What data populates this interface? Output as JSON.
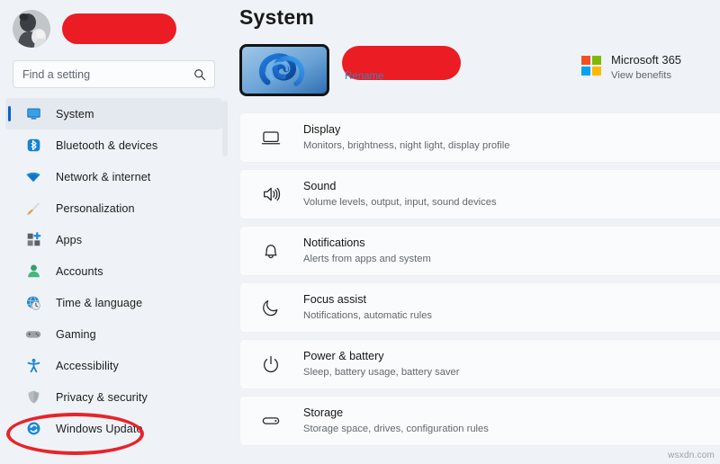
{
  "sidebar": {
    "account": {
      "avatar_name": "user-avatar",
      "name_redacted": true
    },
    "search": {
      "placeholder": "Find a setting",
      "value": "",
      "icon": "search-icon"
    },
    "items": [
      {
        "label": "System",
        "icon": "monitor-icon",
        "selected": true
      },
      {
        "label": "Bluetooth & devices",
        "icon": "bluetooth-icon",
        "selected": false
      },
      {
        "label": "Network & internet",
        "icon": "wifi-icon",
        "selected": false
      },
      {
        "label": "Personalization",
        "icon": "paintbrush-icon",
        "selected": false
      },
      {
        "label": "Apps",
        "icon": "apps-grid-icon",
        "selected": false
      },
      {
        "label": "Accounts",
        "icon": "person-icon",
        "selected": false
      },
      {
        "label": "Time & language",
        "icon": "globe-clock-icon",
        "selected": false
      },
      {
        "label": "Gaming",
        "icon": "gamepad-icon",
        "selected": false
      },
      {
        "label": "Accessibility",
        "icon": "accessibility-icon",
        "selected": false
      },
      {
        "label": "Privacy & security",
        "icon": "shield-icon",
        "selected": false
      },
      {
        "label": "Windows Update",
        "icon": "update-refresh-icon",
        "selected": false
      }
    ],
    "annotation": {
      "target_label": "Windows Update",
      "shape": "ellipse",
      "color": "#e8232a"
    }
  },
  "main": {
    "title": "System",
    "device": {
      "thumbnail": "windows11-bloom-wallpaper",
      "name_redacted": true,
      "rename_label": "Rename"
    },
    "microsoft365": {
      "title": "Microsoft 365",
      "subtitle": "View benefits",
      "logo_colors": [
        "#f25022",
        "#7fba00",
        "#00a4ef",
        "#ffb900"
      ]
    },
    "settings": [
      {
        "title": "Display",
        "subtitle": "Monitors, brightness, night light, display profile",
        "icon": "display-monitor-icon"
      },
      {
        "title": "Sound",
        "subtitle": "Volume levels, output, input, sound devices",
        "icon": "speaker-icon"
      },
      {
        "title": "Notifications",
        "subtitle": "Alerts from apps and system",
        "icon": "bell-icon"
      },
      {
        "title": "Focus assist",
        "subtitle": "Notifications, automatic rules",
        "icon": "moon-icon"
      },
      {
        "title": "Power & battery",
        "subtitle": "Sleep, battery usage, battery saver",
        "icon": "power-icon"
      },
      {
        "title": "Storage",
        "subtitle": "Storage space, drives, configuration rules",
        "icon": "storage-drive-icon"
      }
    ]
  },
  "watermark": "wsxdn.com",
  "colors": {
    "accent": "#0a61d0",
    "redaction": "#ec1c24",
    "annotation": "#e8232a",
    "link": "#4b7bb5",
    "background": "#eff3f7",
    "card": "#fafbfc"
  }
}
